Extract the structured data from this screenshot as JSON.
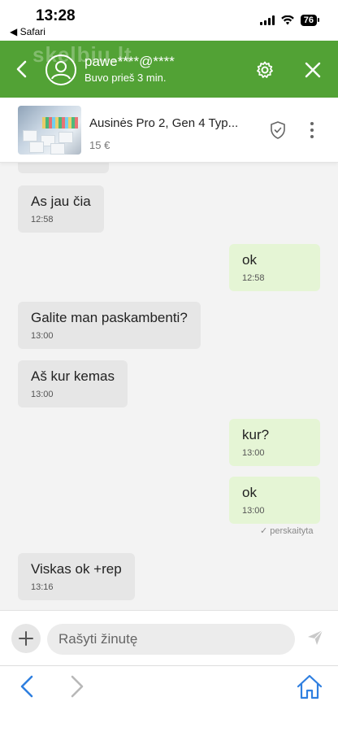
{
  "status_bar": {
    "time": "13:28",
    "back_label": "◀ Safari",
    "battery": "76"
  },
  "header": {
    "watermark": "skelbiu.lt",
    "name": "pawe****@****",
    "status": "Buvo prieš 3 min.",
    "accent": "#52a235"
  },
  "listing": {
    "title": "Ausinės Pro 2, Gen 4 Typ...",
    "price": "15 €"
  },
  "messages": [
    {
      "dir": "in",
      "text": "As jau čia",
      "time": "12:58"
    },
    {
      "dir": "out",
      "text": "ok",
      "time": "12:58"
    },
    {
      "dir": "in",
      "text": "Galite man paskambenti?",
      "time": "13:00"
    },
    {
      "dir": "in",
      "text": "Aš kur kemas",
      "time": "13:00"
    },
    {
      "dir": "out",
      "text": "kur?",
      "time": "13:00"
    },
    {
      "dir": "out",
      "text": "ok",
      "time": "13:00"
    },
    {
      "dir": "in",
      "text": "Viskas ok +rep",
      "time": "13:16"
    }
  ],
  "read_receipt": "✓ perskaityta",
  "composer": {
    "placeholder": "Rašyti žinutę"
  }
}
